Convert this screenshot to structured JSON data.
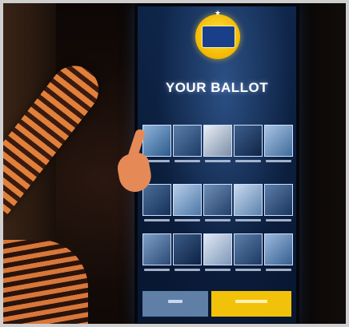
{
  "ballot": {
    "title": "YOUR BALLOT"
  }
}
